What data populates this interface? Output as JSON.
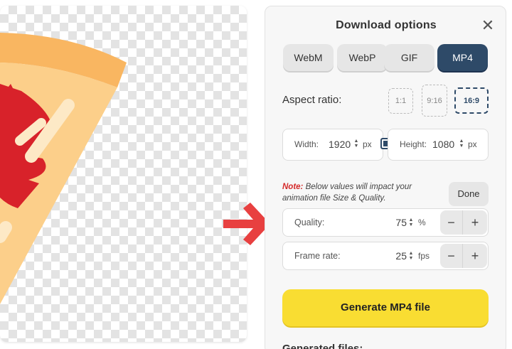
{
  "panel": {
    "title": "Download options",
    "close_icon": "close-icon"
  },
  "formats": [
    {
      "label": "WebM",
      "active": false
    },
    {
      "label": "WebP",
      "active": false
    },
    {
      "label": "GIF",
      "active": false
    },
    {
      "label": "MP4",
      "active": true
    }
  ],
  "aspect": {
    "label": "Aspect ratio:",
    "options": [
      {
        "label": "1:1",
        "active": false
      },
      {
        "label": "9:16",
        "active": false
      },
      {
        "label": "16:9",
        "active": true
      }
    ]
  },
  "dimensions": {
    "width_label": "Width:",
    "width_value": "1920",
    "width_unit": "px",
    "height_label": "Height:",
    "height_value": "1080",
    "height_unit": "px",
    "lock_icon": "aspect-lock-checkbox"
  },
  "note": {
    "prefix": "Note:",
    "text": " Below values will impact your animation file Size & Quality.",
    "done_label": "Done"
  },
  "quality": {
    "label": "Quality:",
    "value": "75",
    "unit": "%"
  },
  "frame_rate": {
    "label": "Frame rate:",
    "value": "25",
    "unit": "fps"
  },
  "stepper": {
    "minus": "−",
    "plus": "+"
  },
  "generate_label": "Generate MP4 file",
  "generated_files_label": "Generated files:",
  "colors": {
    "accent": "#2e4a68",
    "generate_button": "#f9dd32",
    "arrow": "#e84040",
    "note_red": "#d42a2a"
  }
}
